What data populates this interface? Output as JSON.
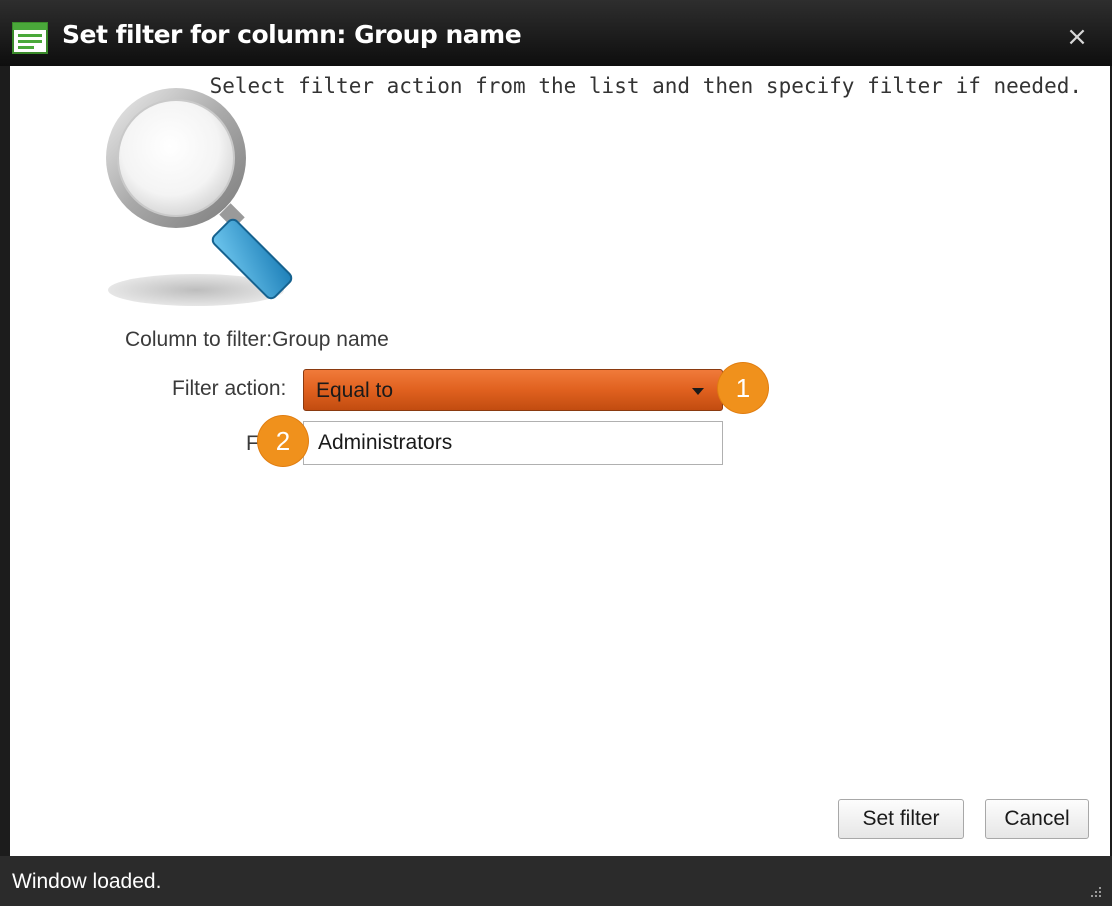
{
  "window": {
    "title": "Set filter for column: Group name",
    "close_glyph": "×",
    "title_icon": "form-icon",
    "close_icon": "close-icon"
  },
  "content": {
    "instructions": "Select filter action from the list and then specify filter if needed.",
    "illustration_icon": "magnifier-icon",
    "column_label": "Column to filter:",
    "column_value": "Group name",
    "action_label": "Filter action:",
    "action_value": "Equal to",
    "filter_label": "F",
    "filter_value": "Administrators"
  },
  "callouts": [
    "1",
    "2"
  ],
  "buttons": {
    "set_filter": "Set filter",
    "cancel": "Cancel"
  },
  "status": {
    "text": "Window loaded.",
    "grip_icon": "resize-grip-icon"
  },
  "colors": {
    "dropdown_accent": "#e0611f",
    "callout": "#f0911c",
    "title_bar": "#111111"
  }
}
